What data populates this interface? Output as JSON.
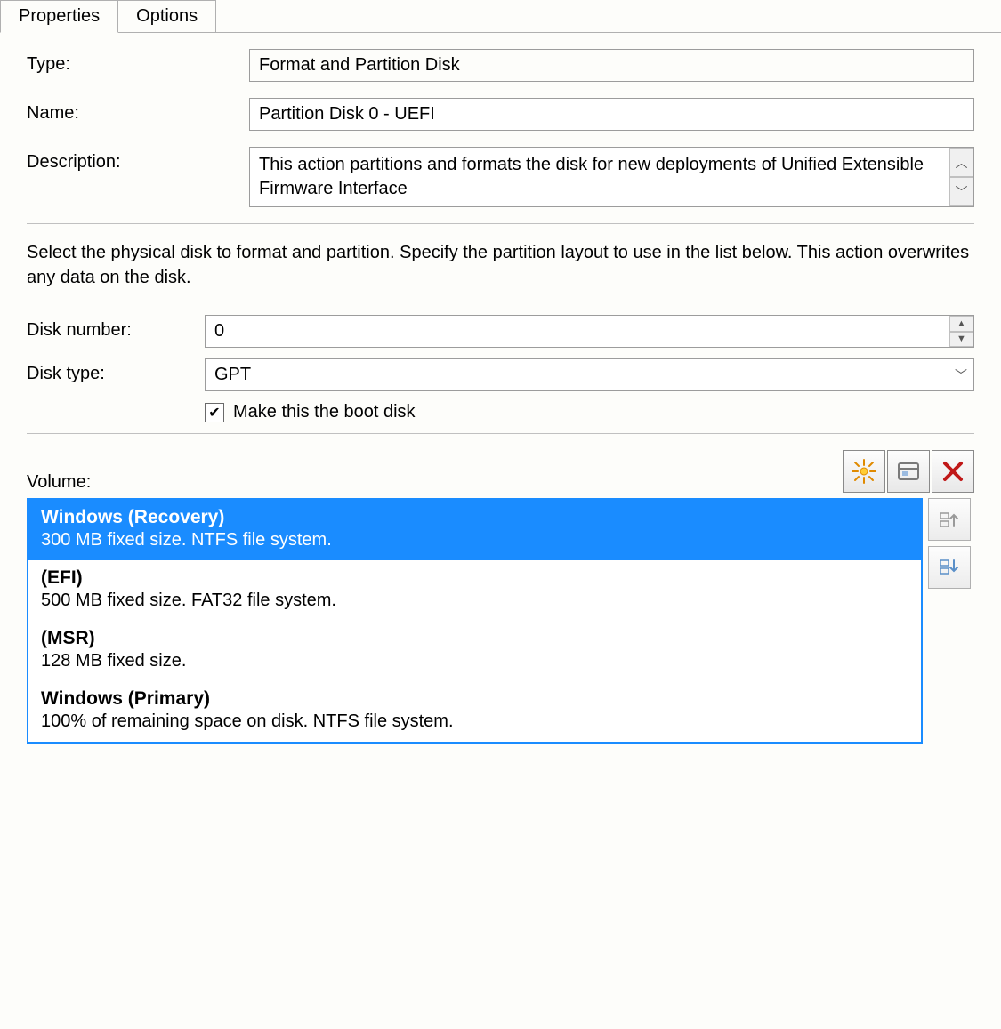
{
  "tabs": [
    {
      "label": "Properties",
      "active": true
    },
    {
      "label": "Options",
      "active": false
    }
  ],
  "fields": {
    "type_label": "Type:",
    "type_value": "Format and Partition Disk",
    "name_label": "Name:",
    "name_value": "Partition Disk 0 - UEFI",
    "desc_label": "Description:",
    "desc_value": "This action partitions and formats the disk for new deployments of Unified Extensible Firmware Interface"
  },
  "instructions": "Select the physical disk to format and partition. Specify the partition layout to use in the list below. This action overwrites any data on the disk.",
  "disk": {
    "number_label": "Disk number:",
    "number_value": "0",
    "type_label": "Disk type:",
    "type_value": "GPT",
    "boot_label": "Make this the boot disk",
    "boot_checked": true
  },
  "volume": {
    "label": "Volume:",
    "items": [
      {
        "title": "Windows (Recovery)",
        "sub": "300 MB fixed size. NTFS file system.",
        "selected": true
      },
      {
        "title": "(EFI)",
        "sub": "500 MB fixed size. FAT32 file system.",
        "selected": false
      },
      {
        "title": "(MSR)",
        "sub": "128 MB fixed size.",
        "selected": false
      },
      {
        "title": "Windows (Primary)",
        "sub": "100% of remaining space on disk. NTFS file system.",
        "selected": false
      }
    ]
  },
  "check_glyph": "✔"
}
